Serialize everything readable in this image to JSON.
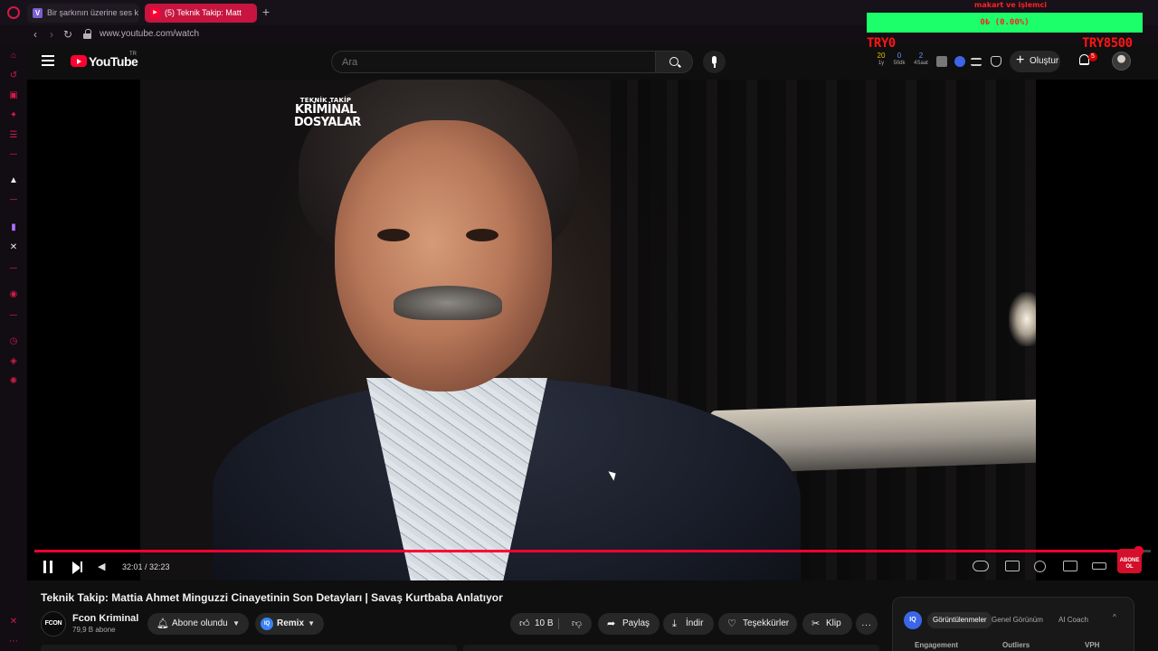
{
  "browser": {
    "tabs": [
      {
        "label": "Bir şarkının üzerine ses k",
        "active": false
      },
      {
        "label": "(5) Teknik Takip: Matt",
        "active": true
      }
    ],
    "new_tab": "+",
    "url": "www.youtube.com/watch"
  },
  "overlay": {
    "top_text": "makart ve işlemci",
    "bar_text": "0₺ (0.00%)",
    "left_text": "TRY0",
    "right_text": "TRY8500"
  },
  "masthead": {
    "logo_text": "YouTube",
    "region": "TR",
    "search_placeholder": "Ara",
    "ext_stats": [
      {
        "num": "20",
        "label": "1y"
      },
      {
        "num": "0",
        "label": "50dk"
      },
      {
        "num": "2",
        "label": "4Saat"
      }
    ],
    "create_label": "Oluştur",
    "notification_count": "5"
  },
  "video": {
    "watermark": [
      "TEKNİK TAKİP",
      "KRİMİNAL",
      "DOSYALAR"
    ],
    "time": "32:01 / 32:23",
    "progress": 0.989,
    "subscribe_badge": "ABONE OL",
    "title": "Teknik Takip: Mattia Ahmet Minguzzi Cinayetinin Son Detayları | Savaş Kurtbaba Anlatıyor"
  },
  "channel": {
    "avatar_text": "FCON",
    "name": "Fcon Kriminal",
    "subscribers": "79,9 B abone",
    "subscribed_label": "Abone olundu"
  },
  "actions": {
    "remix": "Remix",
    "remix_badge": "IQ",
    "likes": "10 B",
    "share": "Paylaş",
    "download": "İndir",
    "thanks": "Teşekkürler",
    "clip": "Klip",
    "more": "..."
  },
  "panel": {
    "badge": "IQ",
    "tabs": [
      "Görüntülenmeler",
      "Genel Görünüm",
      "AI Coach"
    ],
    "columns": [
      "Engagement",
      "Outliers",
      "VPH"
    ]
  },
  "colors": {
    "accent": "#ff0033",
    "overlay_green": "#1cff6a",
    "overlay_red": "#ff1414",
    "browser_accent": "#d11a4a"
  }
}
